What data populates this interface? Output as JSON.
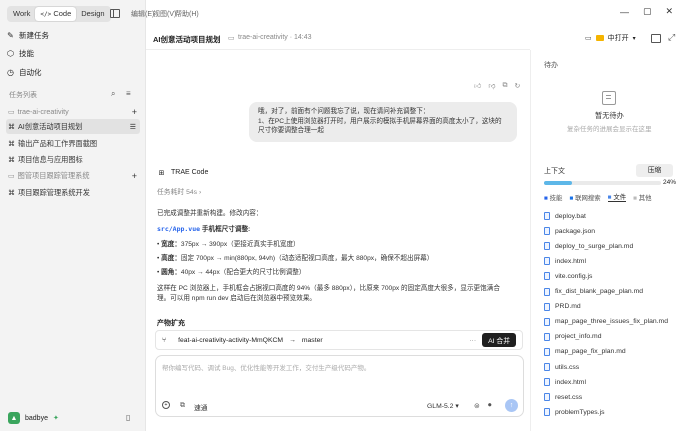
{
  "app": {
    "modes": [
      "Work",
      "Code",
      "Design"
    ],
    "menus": [
      "编辑(E)",
      "视图(V)",
      "帮助(H)"
    ]
  },
  "sidebar": {
    "new_task": "新建任务",
    "skills": "技能",
    "automation": "自动化",
    "task_list_label": "任务列表",
    "group1": "trae-ai-creativity",
    "tasks": [
      "AI创意活动项目规划",
      "输出产品和工作界面截图",
      "项目信息与应用图标"
    ],
    "group2": "图管项目跟踪管理系统",
    "task4": "项目跟踪管理系统开发",
    "user": "badbye"
  },
  "header": {
    "title": "AI创意活动项目规划",
    "subtitle": "trae-ai-creativity · 14:43",
    "open_in": "中打开"
  },
  "chat": {
    "user_msg_line1": "哦，对了，前面有个问题我忘了说，现在请问补充调整下：",
    "user_msg_line2": "1、在PC上使用浏览器打开时，用户展示的模拟手机屏幕界面的高度太小了，这块的尺寸你要调整合理一起",
    "agent_name": "TRAE Code",
    "elapsed": "任务耗时 54s",
    "done_text": "已完成调整并重新构建。修改内容：",
    "file_name": "src/App.vue",
    "file_desc": "手机框尺寸调整:",
    "bullet1_label": "宽度：",
    "bullet1_value": "375px → 390px（更接近真实手机宽度）",
    "bullet2_label": "高度：",
    "bullet2_value": "固定 700px → min(880px, 94vh)（动态适配视口高度，最大 880px，确保不超出屏幕）",
    "bullet3_label": "圆角：",
    "bullet3_value": "40px → 44px（配合更大的尺寸比例调整）",
    "summary_line1": "这样在 PC 浏览器上，手机框会占据视口高度的 94%（最多 880px），比原来 700px 的固定高度大很多，显示更饱满合",
    "summary_line2": "理。可以用 npm run dev 启动后在浏览器中预览效果。",
    "artifacts_label": "产物扩充",
    "branch": "feat-ai-creativity-activity-MmQKCM",
    "target_branch": "master",
    "merge_button": "AI 合并"
  },
  "input": {
    "placeholder": "帮你编写代码、调试 Bug、优化性能等开发工作，交付生产级代码产物。",
    "tools_label": "速通",
    "model": "GLM-5.2"
  },
  "right": {
    "todo_label": "待办",
    "todo_empty": "暂无待办",
    "todo_hint": "复杂任务的进展会显示在这里",
    "context_label": "上下文",
    "compress_button": "压缩",
    "context_percent": "24%",
    "context_fraction": 0.24,
    "filters": [
      "技能",
      "联网搜索",
      "文件",
      "其他"
    ],
    "files": [
      "deploy.bat",
      "package.json",
      "deploy_to_surge_plan.md",
      "index.html",
      "vite.config.js",
      "fix_dist_blank_page_plan.md",
      "PRD.md",
      "map_page_three_issues_fix_plan.md",
      "project_info.md",
      "map_page_fix_plan.md",
      "utils.css",
      "index.html",
      "reset.css",
      "problemTypes.js"
    ]
  }
}
